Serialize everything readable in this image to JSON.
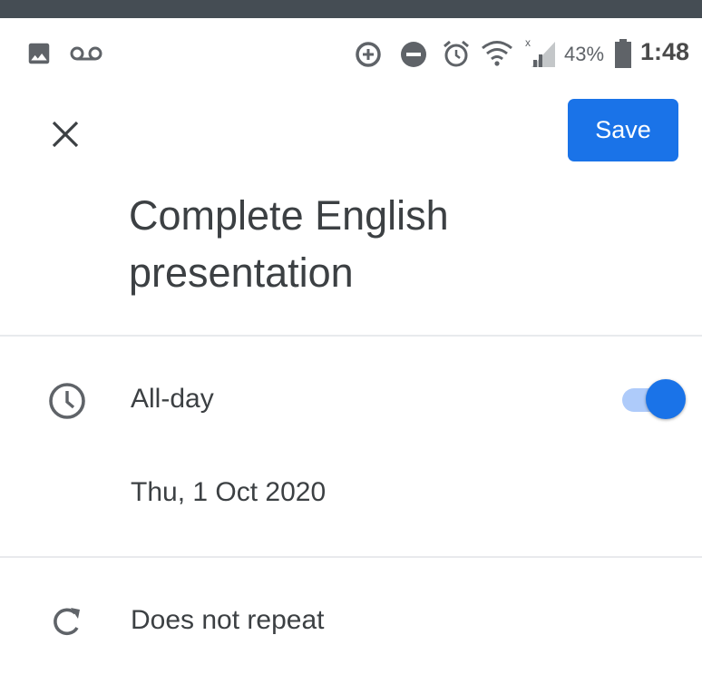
{
  "status_bar": {
    "battery_percent": "43%",
    "time": "1:48",
    "icons": [
      "image-icon",
      "voicemail-icon",
      "data-saver-icon",
      "do-not-disturb-icon",
      "alarm-icon",
      "wifi-icon",
      "signal-icon",
      "battery-icon"
    ]
  },
  "toolbar": {
    "close_icon": "close-icon",
    "save_label": "Save"
  },
  "event": {
    "title": "Complete English presentation",
    "all_day_label": "All-day",
    "all_day_enabled": true,
    "date": "Thu, 1 Oct 2020",
    "repeat": "Does not repeat"
  },
  "colors": {
    "accent": "#1a73e8",
    "toggle_track": "#aecbfa",
    "text": "#3c4043",
    "status_strip": "#454d54"
  }
}
